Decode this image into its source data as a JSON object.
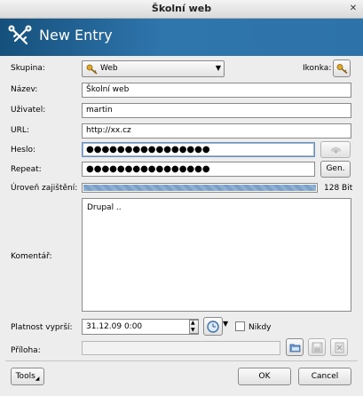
{
  "window": {
    "title": "Školní web",
    "controls": {
      "close": "✕"
    }
  },
  "banner": {
    "title": "New Entry"
  },
  "form": {
    "group": {
      "label": "Skupina:",
      "value": "Web"
    },
    "icon": {
      "label": "Ikonka:"
    },
    "title": {
      "label": "Název:",
      "value": "Školní web"
    },
    "user": {
      "label": "Uživatel:",
      "value": "martin"
    },
    "url": {
      "label": "URL:",
      "value": "http://xx.cz"
    },
    "password": {
      "label": "Heslo:",
      "value": "●●●●●●●●●●●●●●●●"
    },
    "repeat": {
      "label": "Repeat:",
      "value": "●●●●●●●●●●●●●●●●",
      "gen_label": "Gen."
    },
    "quality": {
      "label": "Úroveň zajištění:",
      "value_text": "128 Bit",
      "fill": 1.0
    },
    "comment": {
      "label": "Komentář:",
      "value": "Drupal .."
    },
    "expires": {
      "label": "Platnost vyprší:",
      "value": "31.12.09 0:00",
      "never_label": "Nikdy",
      "never_checked": false
    },
    "attachment": {
      "label": "Příloha:",
      "value": ""
    }
  },
  "footer": {
    "tools_label": "Tools",
    "ok_label": "OK",
    "cancel_label": "Cancel"
  },
  "colors": {
    "banner": "#2d73a9",
    "key_icon": "#d9a21b"
  }
}
